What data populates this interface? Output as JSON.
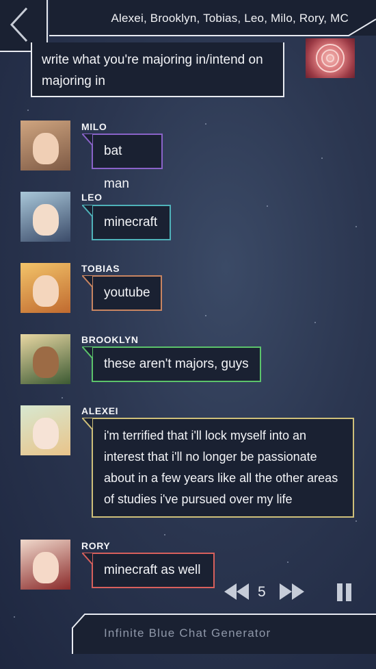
{
  "header": {
    "title": "Alexei, Brooklyn, Tobias, Leo, Milo, Rory, MC",
    "back_icon": "chevron-left-icon"
  },
  "mc_message": {
    "text": "write what you're majoring in/intend on majoring in",
    "avatar_icon": "rose-avatar"
  },
  "messages": [
    {
      "name": "MILO",
      "text": "bat man",
      "color": "#8a63c9"
    },
    {
      "name": "LEO",
      "text": "minecraft",
      "color": "#4fb3ba"
    },
    {
      "name": "TOBIAS",
      "text": "youtube",
      "color": "#c98561"
    },
    {
      "name": "BROOKLYN",
      "text": "these aren't majors, guys",
      "color": "#5cc46b"
    },
    {
      "name": "ALEXEI",
      "text": "i'm terrified that i'll lock myself into an interest that i'll no longer be passionate about in a few years like all the other areas of studies i've pursued over my life",
      "color": "#cfc07a"
    },
    {
      "name": "RORY",
      "text": "minecraft as well",
      "color": "#d8605c"
    }
  ],
  "controls": {
    "speed": "5",
    "rewind_icon": "rewind-icon",
    "forward_icon": "fast-forward-icon",
    "pause_icon": "pause-icon"
  },
  "footer": {
    "text": "Infinite Blue Chat Generator"
  }
}
